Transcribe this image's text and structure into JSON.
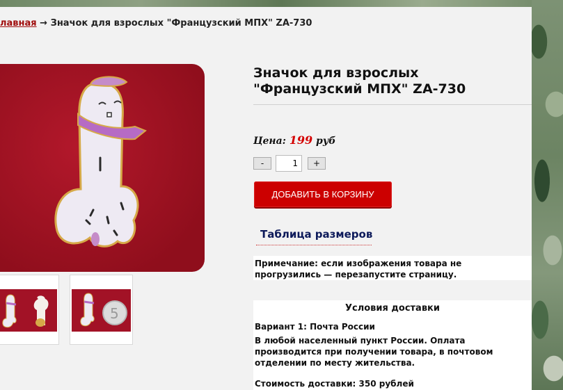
{
  "breadcrumb": {
    "home": "лавная",
    "arrow": "→",
    "current": "Значок для взрослых \"Французский МПХ\" ZA-730"
  },
  "product": {
    "title": "Значок для взрослых \"Французский МПХ\" ZA-730",
    "price_label": "Цена:",
    "price_value": "199",
    "price_currency": "руб",
    "qty_minus": "-",
    "qty_value": "1",
    "qty_plus": "+",
    "add_to_cart": "ДОБАВИТЬ В КОРЗИНУ",
    "size_table": "Таблица размеров",
    "note": "Примечание: если изображения товара не прогрузились — перезапустите страницу."
  },
  "delivery": {
    "heading": "Условия доставки",
    "variant1": "Вариант 1: Почта России",
    "variant1_text": "В любой населенный пункт России. Оплата производится при получении товара, в почтовом отделении по месту жительства.",
    "cost": "Стоимость доставки: 350 рублей"
  },
  "thumb2": {
    "coin_digit": "5"
  },
  "colors": {
    "accent_red": "#cc0000",
    "price_red": "#d40000",
    "link_red": "#a00d0d",
    "size_table_blue": "#0d1a5a"
  }
}
